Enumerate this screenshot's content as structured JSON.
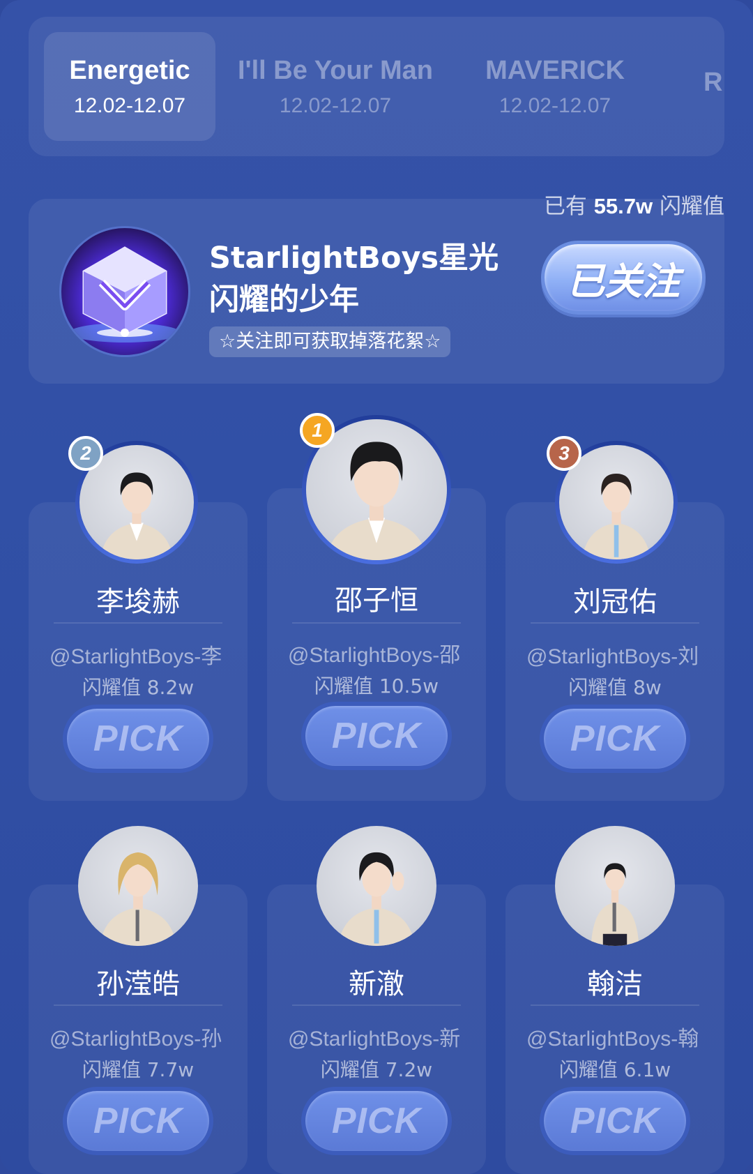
{
  "tabs": [
    {
      "title": "Energetic",
      "date": "12.02-12.07",
      "active": true
    },
    {
      "title": "I'll Be Your Man",
      "date": "12.02-12.07",
      "active": false
    },
    {
      "title": "MAVERICK",
      "date": "12.02-12.07",
      "active": false
    },
    {
      "title": "R",
      "date": "",
      "active": false
    }
  ],
  "banner": {
    "shine_prefix": "已有",
    "shine_total": "55.7w",
    "shine_suffix": "闪耀值",
    "account_name": "StarlightBoys星光闪耀的少年",
    "follow_hint": "☆关注即可获取掉落花絮☆",
    "followed_label": "已关注",
    "logo_icon": "crystal-logo-icon"
  },
  "candidates": [
    {
      "rank": "2",
      "name": "李埈赫",
      "handle": "@StarlightBoys-李",
      "shine": "闪耀值 8.2w",
      "pick": "PICK",
      "hair": "#1b1b1e"
    },
    {
      "rank": "1",
      "name": "邵子恒",
      "handle": "@StarlightBoys-邵",
      "shine": "闪耀值 10.5w",
      "pick": "PICK",
      "hair": "#1a1a1c"
    },
    {
      "rank": "3",
      "name": "刘冠佑",
      "handle": "@StarlightBoys-刘",
      "shine": "闪耀值 8w",
      "pick": "PICK",
      "hair": "#2a2220"
    },
    {
      "rank": "",
      "name": "孙滢皓",
      "handle": "@StarlightBoys-孙",
      "shine": "闪耀值 7.7w",
      "pick": "PICK",
      "hair": "#d9b46a"
    },
    {
      "rank": "",
      "name": "新澈",
      "handle": "@StarlightBoys-新",
      "shine": "闪耀值 7.2w",
      "pick": "PICK",
      "hair": "#1b1b1e"
    },
    {
      "rank": "",
      "name": "翰洁",
      "handle": "@StarlightBoys-翰",
      "shine": "闪耀值 6.1w",
      "pick": "PICK",
      "hair": "#1b1b1e"
    }
  ],
  "colors": {
    "background": "#3150a6",
    "rank1": "#f5a623",
    "rank2": "#7fa2c4",
    "rank3": "#b7654a",
    "pick_button": "#6f90e8"
  }
}
